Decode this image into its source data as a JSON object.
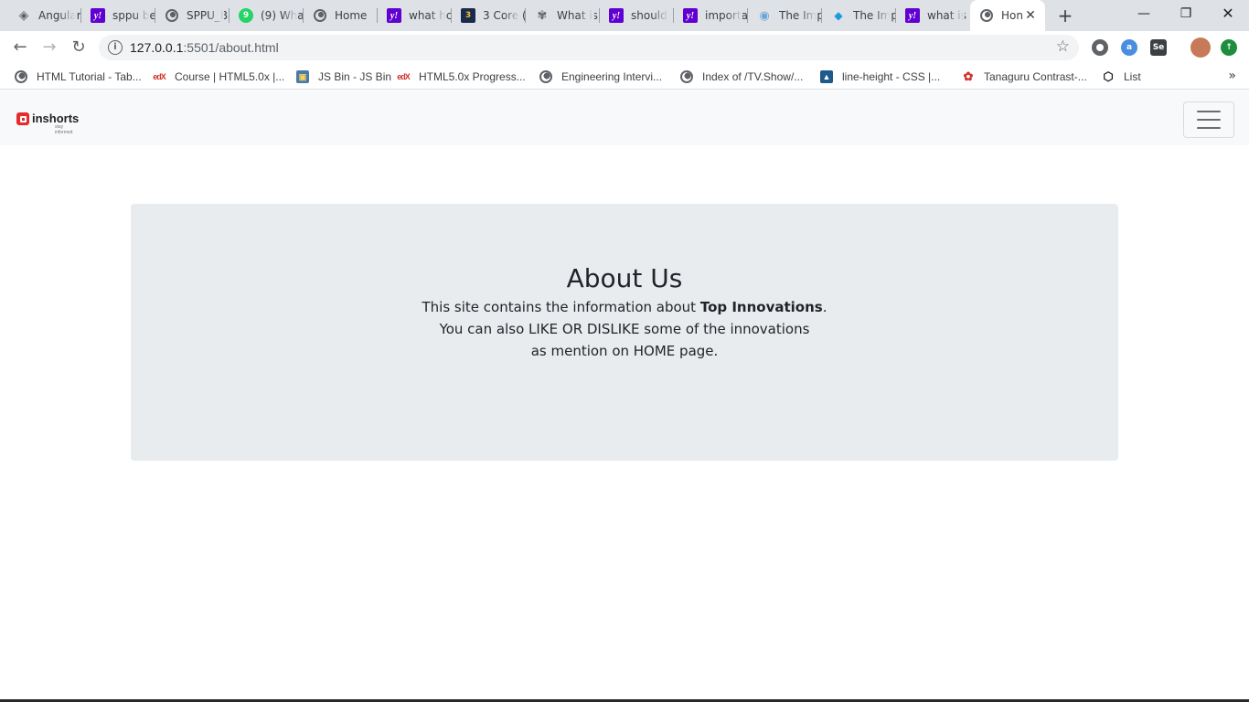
{
  "browser": {
    "tabs": [
      {
        "title": "Angular",
        "icon": "angular-icon"
      },
      {
        "title": "sppu be",
        "icon": "yahoo-icon"
      },
      {
        "title": "SPPU_B",
        "icon": "globe-icon"
      },
      {
        "title": "(9) Wha",
        "icon": "whatsapp-icon"
      },
      {
        "title": "Home",
        "icon": "globe-icon"
      },
      {
        "title": "what hc",
        "icon": "yahoo-icon"
      },
      {
        "title": "3 Core (",
        "icon": "core-icon"
      },
      {
        "title": "What is",
        "icon": "tree-icon"
      },
      {
        "title": "should",
        "icon": "yahoo-icon"
      },
      {
        "title": "importa",
        "icon": "yahoo-icon"
      },
      {
        "title": "The Imp",
        "icon": "eye-icon"
      },
      {
        "title": "The Imp",
        "icon": "diamond-icon"
      },
      {
        "title": "what is",
        "icon": "yahoo-icon"
      },
      {
        "title": "Hon",
        "icon": "globe-icon",
        "active": true
      }
    ],
    "new_tab_glyph": "+",
    "window_controls": {
      "minimize": "—",
      "restore": "❐",
      "close": "✕"
    },
    "nav": {
      "back": "←",
      "forward": "→",
      "reload": "↻"
    },
    "address": {
      "host": "127.0.0.1",
      "path": ":5501/about.html",
      "info_glyph": "i",
      "star_glyph": "☆"
    },
    "bookmarks": [
      {
        "label": "HTML Tutorial - Tab...",
        "icon": "globe-icon"
      },
      {
        "label": "Course | HTML5.0x |...",
        "icon": "edx-icon"
      },
      {
        "label": "JS Bin - JS Bin",
        "icon": "jsbin-icon"
      },
      {
        "label": "HTML5.0x Progress...",
        "icon": "edx-icon"
      },
      {
        "label": "Engineering Intervi...",
        "icon": "globe-icon"
      },
      {
        "label": "Index of /TV.Show/...",
        "icon": "globe-icon"
      },
      {
        "label": "line-height - CSS |...",
        "icon": "mdn-icon"
      },
      {
        "label": "Tanaguru Contrast-...",
        "icon": "tanaguru-icon"
      },
      {
        "label": "List",
        "icon": "codepen-icon"
      }
    ],
    "bookmarks_more": "»"
  },
  "site": {
    "brand": {
      "name": "inshorts",
      "tagline": "stay informed"
    },
    "hero": {
      "title": "About Us",
      "line1_prefix": "This site contains the information about ",
      "line1_bold": "Top Innovations",
      "line1_suffix": ".",
      "line2": "You can also LIKE OR DISLIKE some of the innovations",
      "line3": "as mention on HOME page."
    }
  },
  "colors": {
    "tabstrip": "#dee1e6",
    "navbar_bg": "#f8f9fa",
    "jumbotron_bg": "#e9ecef",
    "brand_red": "#e52b2b"
  }
}
